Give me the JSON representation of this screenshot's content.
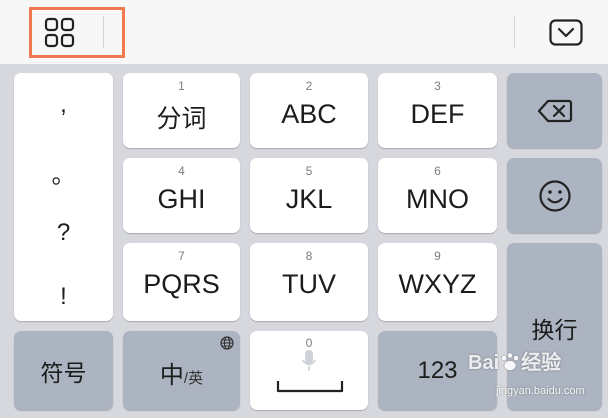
{
  "toolbar": {
    "menu_icon": "grid-four-icon",
    "collapse_icon": "chevron-down-icon",
    "highlight_color": "#ef7a4e"
  },
  "punctuation": [
    ",",
    "。",
    "?",
    "!"
  ],
  "keys": [
    {
      "num": "1",
      "label": "分词"
    },
    {
      "num": "2",
      "label": "ABC"
    },
    {
      "num": "3",
      "label": "DEF"
    },
    {
      "num": "4",
      "label": "GHI"
    },
    {
      "num": "5",
      "label": "JKL"
    },
    {
      "num": "6",
      "label": "MNO"
    },
    {
      "num": "7",
      "label": "PQRS"
    },
    {
      "num": "8",
      "label": "TUV"
    },
    {
      "num": "9",
      "label": "WXYZ"
    }
  ],
  "bottom": {
    "symbols": "符号",
    "lang_primary": "中",
    "lang_secondary": "/英",
    "space_num": "0",
    "numbers": "123",
    "enter": "换行"
  },
  "watermark": {
    "brand": "Bai",
    "brand_suffix": "经验",
    "url": "jingyan.baidu.com"
  },
  "colors": {
    "key_light": "#ffffff",
    "key_dark": "#adb4c1",
    "keyboard_bg": "#d6d8de"
  }
}
